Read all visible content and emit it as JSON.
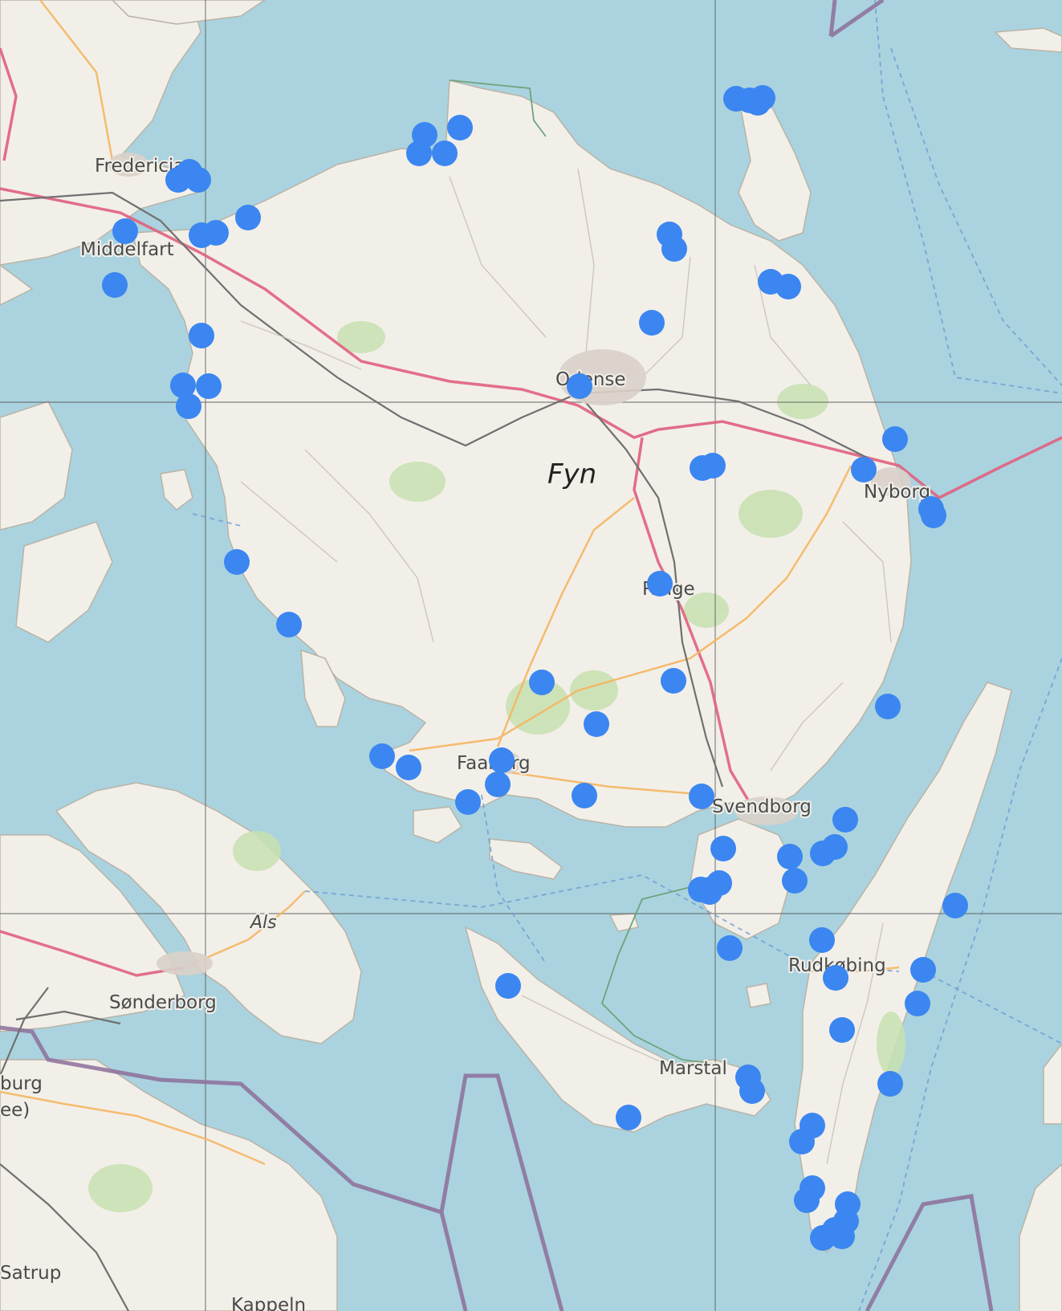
{
  "map": {
    "place_labels": {
      "fredericia": "Fredericia",
      "middelfart": "Middelfart",
      "odense": "Odense",
      "fyn": "Fyn",
      "nyborg": "Nyborg",
      "ringe": "Ringe",
      "faaborg": "Faaborg",
      "svendborg": "Svendborg",
      "als": "Als",
      "sonderborg": "Sønderborg",
      "rudkobing": "Rudkøbing",
      "marstal": "Marstal",
      "flensburg_partial": "burg",
      "flensburg_paren_partial": "ee)",
      "satrup": "Satrup",
      "kappeln_partial": "Kappeln"
    },
    "marker_color": "#3b86f0",
    "land_color": "#f2efe9",
    "water_color": "#aad3df",
    "markers": [
      {
        "id": "m1"
      },
      {
        "id": "m2"
      },
      {
        "id": "m3"
      },
      {
        "id": "m4"
      },
      {
        "id": "m5"
      },
      {
        "id": "m6"
      },
      {
        "id": "m7"
      },
      {
        "id": "m8"
      },
      {
        "id": "m9"
      },
      {
        "id": "m10"
      },
      {
        "id": "m11"
      },
      {
        "id": "m12"
      },
      {
        "id": "m13"
      },
      {
        "id": "m14"
      },
      {
        "id": "m15"
      },
      {
        "id": "m16"
      },
      {
        "id": "m17"
      },
      {
        "id": "m18"
      },
      {
        "id": "m19"
      },
      {
        "id": "m20"
      },
      {
        "id": "m21"
      },
      {
        "id": "m22"
      },
      {
        "id": "m23"
      },
      {
        "id": "m24"
      },
      {
        "id": "m25"
      },
      {
        "id": "m26"
      },
      {
        "id": "m27"
      },
      {
        "id": "m28"
      },
      {
        "id": "m29"
      },
      {
        "id": "m30"
      },
      {
        "id": "m31"
      },
      {
        "id": "m32"
      },
      {
        "id": "m33"
      },
      {
        "id": "m34"
      },
      {
        "id": "m35"
      },
      {
        "id": "m36"
      },
      {
        "id": "m37"
      },
      {
        "id": "m38"
      },
      {
        "id": "m39"
      },
      {
        "id": "m40"
      },
      {
        "id": "m41"
      },
      {
        "id": "m42"
      },
      {
        "id": "m43"
      },
      {
        "id": "m44"
      },
      {
        "id": "m45"
      },
      {
        "id": "m46"
      },
      {
        "id": "m47"
      },
      {
        "id": "m48"
      },
      {
        "id": "m49"
      },
      {
        "id": "m50"
      },
      {
        "id": "m51"
      },
      {
        "id": "m52"
      },
      {
        "id": "m53"
      },
      {
        "id": "m54"
      },
      {
        "id": "m55"
      },
      {
        "id": "m56"
      },
      {
        "id": "m57"
      },
      {
        "id": "m58"
      },
      {
        "id": "m59"
      },
      {
        "id": "m60"
      },
      {
        "id": "m61"
      },
      {
        "id": "m62"
      },
      {
        "id": "m63"
      },
      {
        "id": "m64"
      },
      {
        "id": "m65"
      },
      {
        "id": "m66"
      },
      {
        "id": "m67"
      },
      {
        "id": "m68"
      },
      {
        "id": "m69"
      },
      {
        "id": "m70"
      },
      {
        "id": "m71"
      },
      {
        "id": "m72"
      },
      {
        "id": "m73"
      },
      {
        "id": "m74"
      },
      {
        "id": "m75"
      },
      {
        "id": "m76"
      },
      {
        "id": "m77"
      },
      {
        "id": "m78"
      }
    ]
  }
}
